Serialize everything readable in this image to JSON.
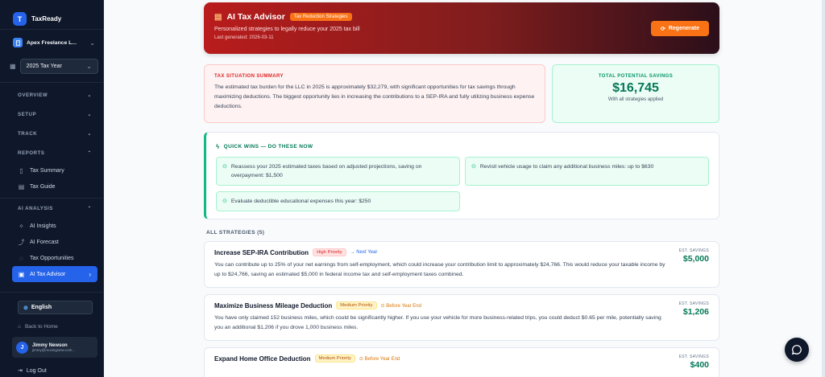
{
  "brand": {
    "logo_letter": "T",
    "name": "TaxReady"
  },
  "org": {
    "name": "Apex Freelance L..."
  },
  "tax_year": {
    "value": "2025 Tax Year"
  },
  "nav": {
    "overview": "OVERVIEW",
    "setup": "SETUP",
    "track": "TRACK",
    "reports": "REPORTS",
    "reports_items": [
      "Tax Summary",
      "Tax Guide"
    ],
    "ai_analysis": "AI ANALYSIS",
    "ai_items": [
      "AI Insights",
      "AI Forecast",
      "Tax Opportunities",
      "AI Tax Advisor"
    ]
  },
  "language": "English",
  "back_home": "Back to Home",
  "user": {
    "initial": "J",
    "name": "Jimmy Newson",
    "email": "jimmy@movingview.com..."
  },
  "logout": "Log Out",
  "hero": {
    "title": "AI Tax Advisor",
    "badge": "Tax Reduction Strategies",
    "subtitle": "Personalized strategies to legally reduce your 2025 tax bill",
    "generated": "Last generated: 2026-03-11",
    "regenerate": "Regenerate"
  },
  "summary": {
    "label": "TAX SITUATION SUMMARY",
    "text": "The estimated tax burden for the LLC in 2025 is approximately $32,279, with significant opportunities for tax savings through maximizing deductions. The biggest opportunity lies in increasing the contributions to a SEP-IRA and fully utilizing business expense deductions."
  },
  "savings": {
    "label": "TOTAL POTENTIAL SAVINGS",
    "value": "$16,745",
    "sub": "With all strategies applied"
  },
  "quick_wins": {
    "title": "QUICK WINS — DO THESE NOW",
    "items": [
      "Reassess your 2025 estimated taxes based on adjusted projections, saving on overpayment: $1,500",
      "Revisit vehicle usage to claim any additional business miles: up to $630",
      "Evaluate deductible educational expenses this year: $250"
    ]
  },
  "all_label": "ALL STRATEGIES (5)",
  "est_label": "EST. SAVINGS",
  "strategies": [
    {
      "title": "Increase SEP-IRA Contribution",
      "priority": "High Priority",
      "timing": "→ Next Year",
      "desc": "You can contribute up to 25% of your net earnings from self-employment, which could increase your contribution limit to approximately $24,766. This would reduce your taxable income by up to $24,766, saving an estimated $5,000 in federal income tax and self-employment taxes combined.",
      "savings": "$5,000"
    },
    {
      "title": "Maximize Business Mileage Deduction",
      "priority": "Medium Priority",
      "timing": "⊙ Before Year End",
      "desc": "You have only claimed 152 business miles, which could be significantly higher. If you use your vehicle for more business-related trips, you could deduct $0.65 per mile, potentially saving you an additional $1,206 if you drove 1,000 business miles.",
      "savings": "$1,206"
    },
    {
      "title": "Expand Home Office Deduction",
      "priority": "Medium Priority",
      "timing": "⊙ Before Year End",
      "desc": "",
      "savings": "$400"
    }
  ]
}
